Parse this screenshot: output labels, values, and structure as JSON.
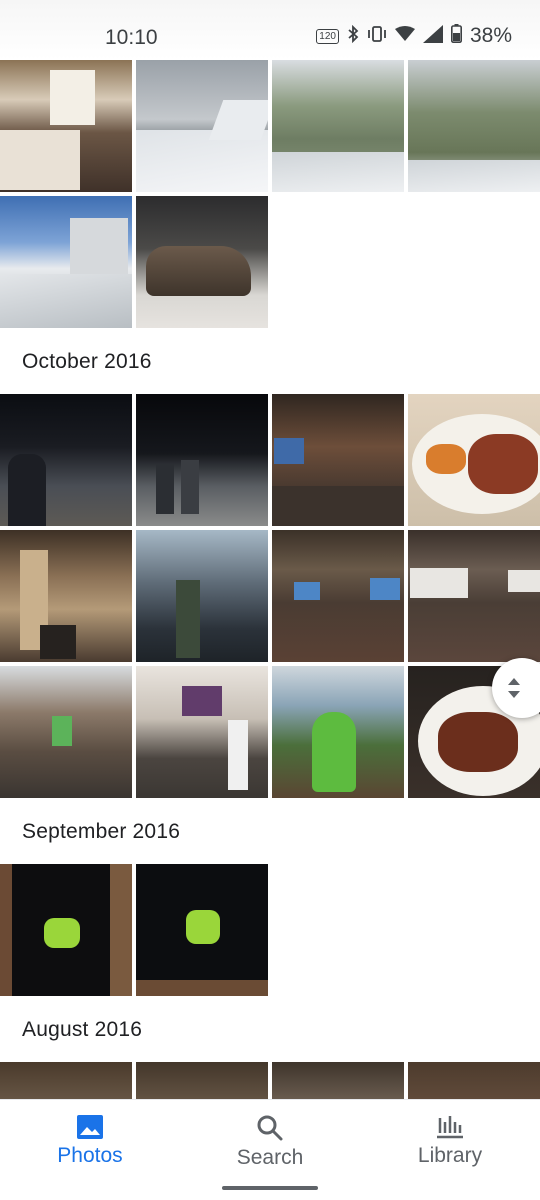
{
  "status_bar": {
    "time": "10:10",
    "refresh_badge": "120",
    "battery_percent": "38%",
    "icons": [
      "refresh-rate-icon",
      "bluetooth-icon",
      "vibrate-icon",
      "wifi-icon",
      "signal-icon",
      "battery-icon"
    ]
  },
  "sections": {
    "october": "October 2016",
    "september": "September 2016",
    "august": "August 2016"
  },
  "bottom_nav": {
    "photos": "Photos",
    "search": "Search",
    "library": "Library"
  },
  "colors": {
    "accent": "#1a73e8",
    "inactive": "#5f6368",
    "header_text": "#202124"
  }
}
